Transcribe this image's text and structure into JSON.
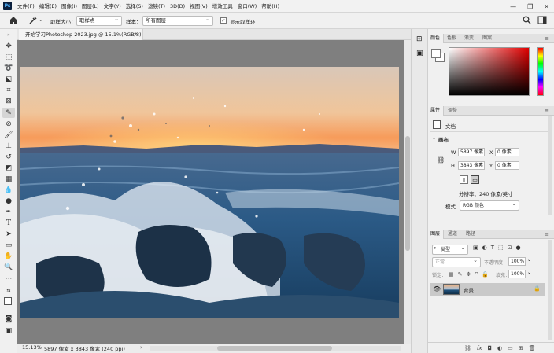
{
  "app": {
    "logo": "Ps",
    "menus": [
      "文件(F)",
      "编辑(E)",
      "图像(I)",
      "图层(L)",
      "文字(Y)",
      "选择(S)",
      "滤镜(T)",
      "3D(D)",
      "视图(V)",
      "增效工具",
      "窗口(W)",
      "帮助(H)"
    ]
  },
  "options_bar": {
    "sample_size_label": "取样大小：",
    "sample_size_value": "取样点",
    "sample_label": "样本：",
    "sample_value": "所有图层",
    "show_ring_label": "显示取样环",
    "show_ring_checked": true
  },
  "document": {
    "tab_title": "开始学习Photoshop 2023.jpg @ 15.1%(RGB/8)",
    "close": "×",
    "zoom": "15.13%",
    "info": "5897 像素 x 3843 像素 (240 ppi)"
  },
  "color_panel": {
    "tabs": [
      "颜色",
      "色板",
      "渐变",
      "图案"
    ],
    "active_tab": 0,
    "foreground": "#ffffff",
    "background": "#ffffff"
  },
  "properties_panel": {
    "tabs": [
      "属性",
      "调整"
    ],
    "active_tab": 0,
    "doc_label": "文档",
    "canvas_label": "画布",
    "w_label": "W",
    "w_value": "5897 像素",
    "h_label": "H",
    "h_value": "3843 像素",
    "x_label": "X",
    "x_value": "0 像素",
    "y_label": "Y",
    "y_value": "0 像素",
    "resolution": "分辨率：240 像素/英寸",
    "mode_label": "模式",
    "mode_value": "RGB 颜色"
  },
  "layers_panel": {
    "tabs": [
      "图层",
      "通道",
      "路径"
    ],
    "active_tab": 0,
    "filter_value": "类型",
    "blend_value": "正常",
    "opacity_label": "不透明度：",
    "opacity_value": "100%",
    "lock_label": "锁定：",
    "fill_label": "填充：",
    "fill_value": "100%",
    "layers": [
      {
        "name": "背景",
        "visible": true,
        "locked": true
      }
    ]
  }
}
